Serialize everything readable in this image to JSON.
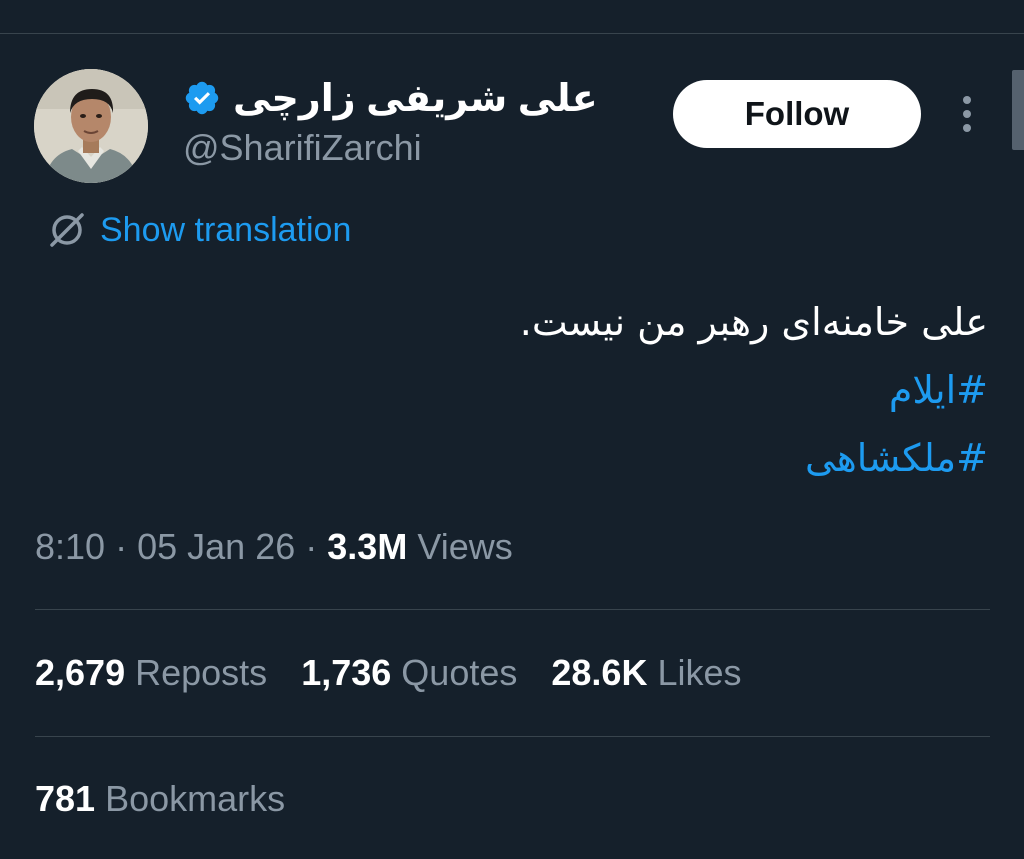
{
  "author": {
    "display_name": "علی شریفی زارچی",
    "handle": "@SharifiZarchi",
    "verified": true
  },
  "header": {
    "follow_label": "Follow",
    "more_icon": "more-vertical-icon"
  },
  "translation": {
    "label": "Show translation",
    "icon": "translate-icon"
  },
  "tweet": {
    "text": "علی خامنه‌ای رهبر من نیست.",
    "hashtags": [
      "#ایلام",
      "#ملکشاهی"
    ]
  },
  "meta": {
    "time": "8:10",
    "date": "05 Jan 26",
    "views_count": "3.3M",
    "views_label": "Views",
    "separator": "·"
  },
  "stats": [
    {
      "count": "2,679",
      "label": "Reposts"
    },
    {
      "count": "1,736",
      "label": "Quotes"
    },
    {
      "count": "28.6K",
      "label": "Likes"
    }
  ],
  "bookmarks": {
    "count": "781",
    "label": "Bookmarks"
  },
  "colors": {
    "background": "#15202b",
    "accent": "#1d9bf0",
    "secondary_text": "#8b98a5",
    "divider": "#38444d"
  }
}
